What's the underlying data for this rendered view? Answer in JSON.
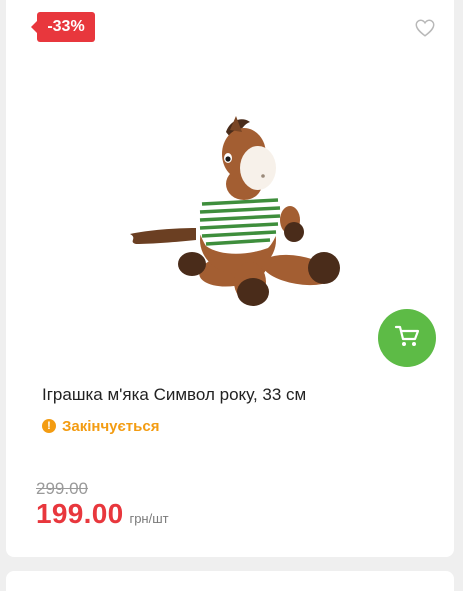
{
  "product": {
    "discount_badge": "-33%",
    "title": "Іграшка м'яка Символ року, 33 см",
    "stock_status": "Закінчується",
    "stock_status_icon": "warning-icon",
    "old_price": "299.00",
    "current_price": "199.00",
    "unit": "грн/шт"
  },
  "icons": {
    "favorite": "heart-icon",
    "cart": "shopping-cart-icon"
  },
  "colors": {
    "discount": "#e8373d",
    "price": "#e8373d",
    "cart_button": "#5dbb46",
    "stock_warning": "#f39c12"
  }
}
